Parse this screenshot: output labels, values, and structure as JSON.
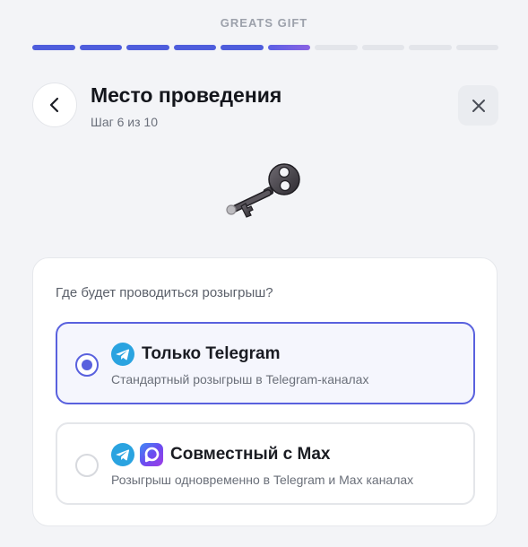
{
  "header": {
    "app_title": "GREATS GIFT",
    "progress": {
      "total": 10,
      "completed": 5,
      "current": 6
    }
  },
  "page": {
    "title": "Место проведения",
    "subtitle": "Шаг 6 из 10",
    "hero_icon": "old-key-icon"
  },
  "icons": {
    "back": "chevron-left-icon",
    "close": "close-icon",
    "telegram": "telegram-icon",
    "max": "max-icon"
  },
  "form": {
    "question": "Где будет проводиться розыгрыш?",
    "options": [
      {
        "title": "Только Telegram",
        "description": "Стандартный розыгрыш в Telegram-каналах",
        "selected": true,
        "icons": [
          "telegram-icon"
        ]
      },
      {
        "title": "Совместный с Max",
        "description": "Розыгрыш одновременно в Telegram и Max каналах",
        "selected": false,
        "icons": [
          "telegram-icon",
          "max-icon"
        ]
      }
    ]
  },
  "colors": {
    "accent": "#5961de",
    "progress_done": "#4e5ddc",
    "progress_todo": "#e3e5ea",
    "telegram": "#2aa3e0",
    "background": "#f3f4f7"
  }
}
